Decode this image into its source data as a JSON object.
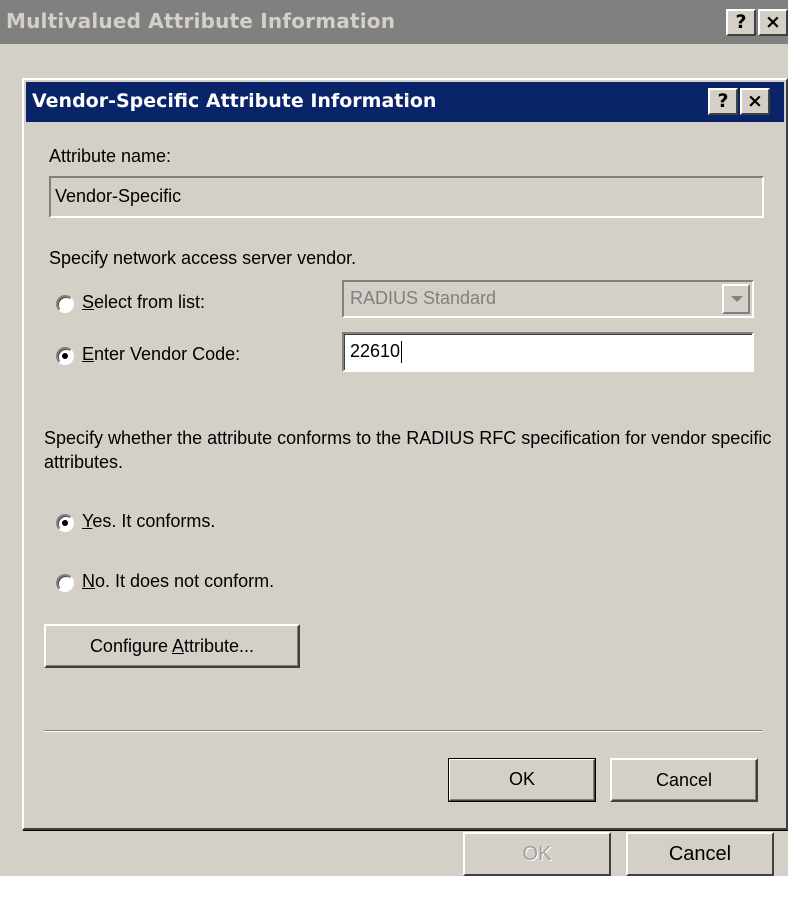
{
  "parent_dialog": {
    "title": "Multivalued Attribute Information",
    "help_button": "?",
    "close_button": "×",
    "ok_label": "OK",
    "cancel_label": "Cancel"
  },
  "dialog": {
    "title": "Vendor-Specific Attribute Information",
    "help_button": "?",
    "close_button": "×",
    "attribute_name_label": "Attribute name:",
    "attribute_name_value": "Vendor-Specific",
    "vendor_prompt": "Specify network access server vendor.",
    "select_from_list": {
      "accel": "S",
      "rest": "elect from list:",
      "checked": false
    },
    "vendor_dropdown_value": "RADIUS Standard",
    "enter_vendor_code": {
      "accel": "E",
      "rest": "nter Vendor Code:",
      "checked": true
    },
    "vendor_code_value": "22610",
    "conform_prompt": "Specify whether the attribute conforms to the RADIUS RFC specification for vendor specific attributes.",
    "yes_option": {
      "accel": "Y",
      "rest": "es. It conforms.",
      "checked": true
    },
    "no_option": {
      "accel": "N",
      "rest": "o. It does not conform.",
      "checked": false
    },
    "configure_button": {
      "before": "Configure ",
      "accel": "A",
      "after": "ttribute..."
    },
    "ok_label": "OK",
    "cancel_label": "Cancel"
  },
  "colors": {
    "active_title": "#0a246a",
    "inactive_title": "#808080",
    "face": "#d4d0c8"
  }
}
